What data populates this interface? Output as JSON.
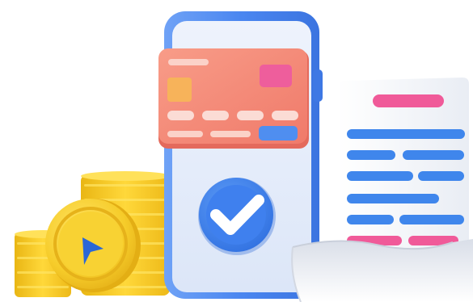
{
  "illustration": {
    "subject": "mobile-payment-success",
    "icons": {
      "coin_stack": "coin-stack-icon",
      "coin_front": "coin-play-icon",
      "phone": "smartphone-icon",
      "card": "credit-card-icon",
      "check": "checkmark-badge-icon",
      "receipt": "receipt-icon"
    },
    "colors": {
      "gold": "#F6CC2A",
      "gold_dark": "#E3AE14",
      "gold_light": "#FFE15A",
      "phone_frame": "#4A86F0",
      "phone_screen": "#E3ECFB",
      "card": "#F58A78",
      "card_chip": "#F7B35A",
      "card_accent": "#EE5E9C",
      "card_bar": "#4F8EF0",
      "check_badge": "#3E7FEE",
      "receipt_paper": "#F3F5F9",
      "receipt_line_blue": "#3F86EC",
      "receipt_line_pink": "#F05A99",
      "play_triangle": "#2A67D6"
    }
  }
}
